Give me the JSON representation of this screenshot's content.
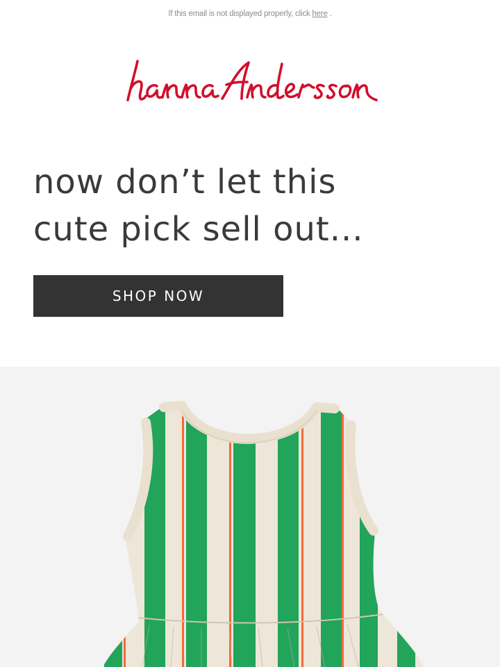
{
  "preheader": {
    "text": "If this email is not displayed properly, click",
    "link_label": "here",
    "suffix": " ."
  },
  "brand": {
    "logo_text": "hanna andersson",
    "logo_color": "#d0102b"
  },
  "hero": {
    "headline_line1": "now don’t let this",
    "headline_line2": "cute pick sell out...",
    "cta_label": "SHOP NOW",
    "cta_color": "#333333"
  },
  "product": {
    "image_name": "striped-sleeveless-dress",
    "stripe_green": "#22a45a",
    "stripe_cream": "#eee6d8",
    "stripe_orange": "#f06a3c",
    "background": "#f3f3f3"
  }
}
